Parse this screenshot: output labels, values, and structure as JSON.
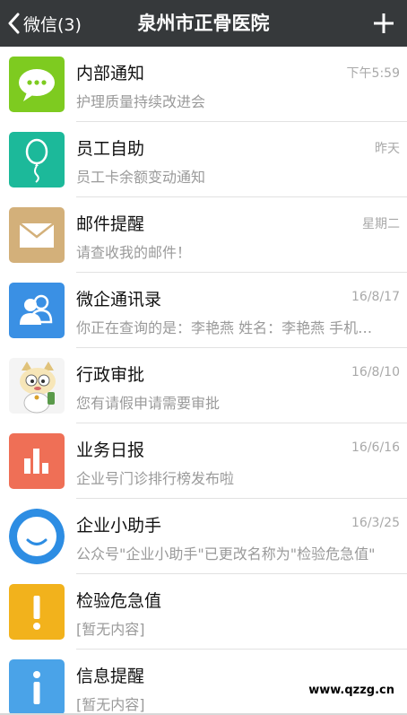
{
  "header": {
    "back_label": "微信(3)",
    "title": "泉州市正骨医院",
    "add_icon": "plus-icon"
  },
  "colors": {
    "header_bg": "#36393b",
    "internal_notice": "#7ecb20",
    "self_service": "#1cb99a",
    "mail": "#d3b07a",
    "contacts": "#3a90e4",
    "reports": "#ef6f56",
    "assistant": "#2d8de3",
    "critical_values": "#f2b21c",
    "info": "#4aa3e8"
  },
  "conversations": [
    {
      "icon": "chat-bubble-icon",
      "title": "内部通知",
      "time": "下午5:59",
      "preview": "护理质量持续改进会"
    },
    {
      "icon": "balloon-icon",
      "title": "员工自助",
      "time": "昨天",
      "preview": "员工卡余额变动通知"
    },
    {
      "icon": "envelope-icon",
      "title": "邮件提醒",
      "time": "星期二",
      "preview": "请查收我的邮件！"
    },
    {
      "icon": "contacts-icon",
      "title": "微企通讯录",
      "time": "16/8/17",
      "preview": "你正在查询的是：李艳燕 姓名：李艳燕 手机…"
    },
    {
      "icon": "cartoon-cat-icon",
      "title": "行政审批",
      "time": "16/8/10",
      "preview": "您有请假申请需要审批"
    },
    {
      "icon": "bar-chart-icon",
      "title": "业务日报",
      "time": "16/6/16",
      "preview": "企业号门诊排行榜发布啦"
    },
    {
      "icon": "smile-bubble-icon",
      "title": "企业小助手",
      "time": "16/3/25",
      "preview": "公众号\"企业小助手\"已更改名称为\"检验危急值\""
    },
    {
      "icon": "exclamation-icon",
      "title": "检验危急值",
      "time": "",
      "preview": "[暂无内容]"
    },
    {
      "icon": "info-icon",
      "title": "信息提醒",
      "time": "",
      "preview": "[暂无内容]"
    }
  ],
  "watermark": "www.qzzg.cn"
}
